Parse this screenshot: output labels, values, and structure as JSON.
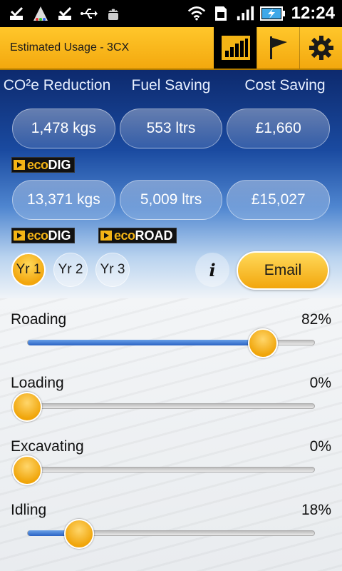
{
  "status_bar": {
    "time": "12:24",
    "icons": [
      "checkmark-notification-icon",
      "color-cone-icon",
      "checkmark-notification-icon",
      "usb-icon",
      "android-icon",
      "wifi-icon",
      "sim-icon",
      "signal-icon",
      "battery-charging-icon"
    ]
  },
  "action_bar": {
    "title": "Estimated Usage - 3CX",
    "buttons": [
      "chart-icon",
      "flag-icon",
      "gear-icon"
    ],
    "active_button": "chart-icon"
  },
  "columns": {
    "co2": "CO²e Reduction",
    "fuel": "Fuel Saving",
    "cost": "Cost Saving"
  },
  "ecodig_row": {
    "co2": "1,478 kgs",
    "fuel": "553 ltrs",
    "cost": "£1,660",
    "logo": {
      "eco": "eco",
      "word": "DIG"
    }
  },
  "combined_row": {
    "co2": "13,371 kgs",
    "fuel": "5,009 ltrs",
    "cost": "£15,027",
    "logos": [
      {
        "eco": "eco",
        "word": "DIG"
      },
      {
        "eco": "eco",
        "word": "ROAD"
      }
    ]
  },
  "year_buttons": {
    "items": [
      "Yr 1",
      "Yr 2",
      "Yr 3"
    ],
    "selected": "Yr 1"
  },
  "info_label": "i",
  "email_label": "Email",
  "sliders": [
    {
      "label": "Roading",
      "percent_text": "82%",
      "value": 0.82
    },
    {
      "label": "Loading",
      "percent_text": "0%",
      "value": 0.0
    },
    {
      "label": "Excavating",
      "percent_text": "0%",
      "value": 0.0
    },
    {
      "label": "Idling",
      "percent_text": "18%",
      "value": 0.18
    }
  ],
  "colors": {
    "accent": "#f4b415",
    "header_blue": "#0d2a6e",
    "slider_fill": "#2a62c4"
  }
}
